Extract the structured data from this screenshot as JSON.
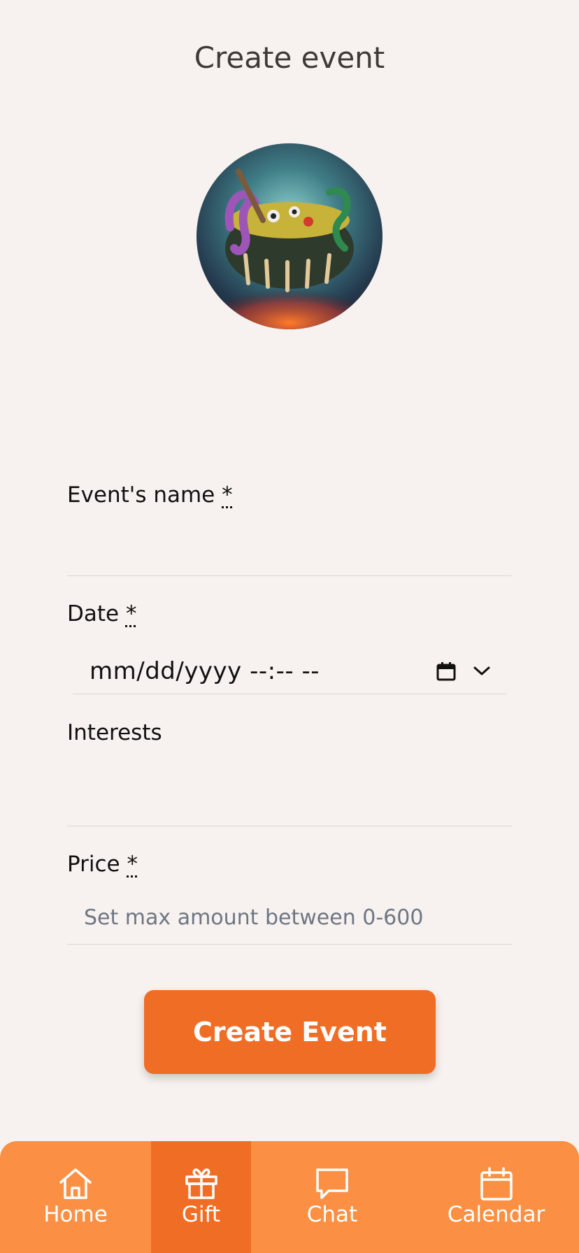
{
  "header": {
    "title": "Create event"
  },
  "avatar": {
    "icon": "cauldron-image"
  },
  "form": {
    "name": {
      "label": "Event's name",
      "required_mark": "*",
      "value": ""
    },
    "date": {
      "label": "Date",
      "required_mark": "*",
      "value": "mm/dd/yyyy --:-- --"
    },
    "interests": {
      "label": "Interests",
      "value": ""
    },
    "price": {
      "label": "Price",
      "required_mark": "*",
      "placeholder": "Set max amount between 0-600"
    }
  },
  "actions": {
    "create_label": "Create Event"
  },
  "nav": {
    "active": "Gift",
    "items": [
      {
        "label": "Home",
        "icon": "home-icon"
      },
      {
        "label": "Gift",
        "icon": "gift-icon"
      },
      {
        "label": "Chat",
        "icon": "chat-icon"
      },
      {
        "label": "Calendar",
        "icon": "calendar-icon"
      }
    ]
  },
  "colors": {
    "background": "#f7f2ef",
    "accent": "#f06d26",
    "nav": "#fb9045"
  }
}
